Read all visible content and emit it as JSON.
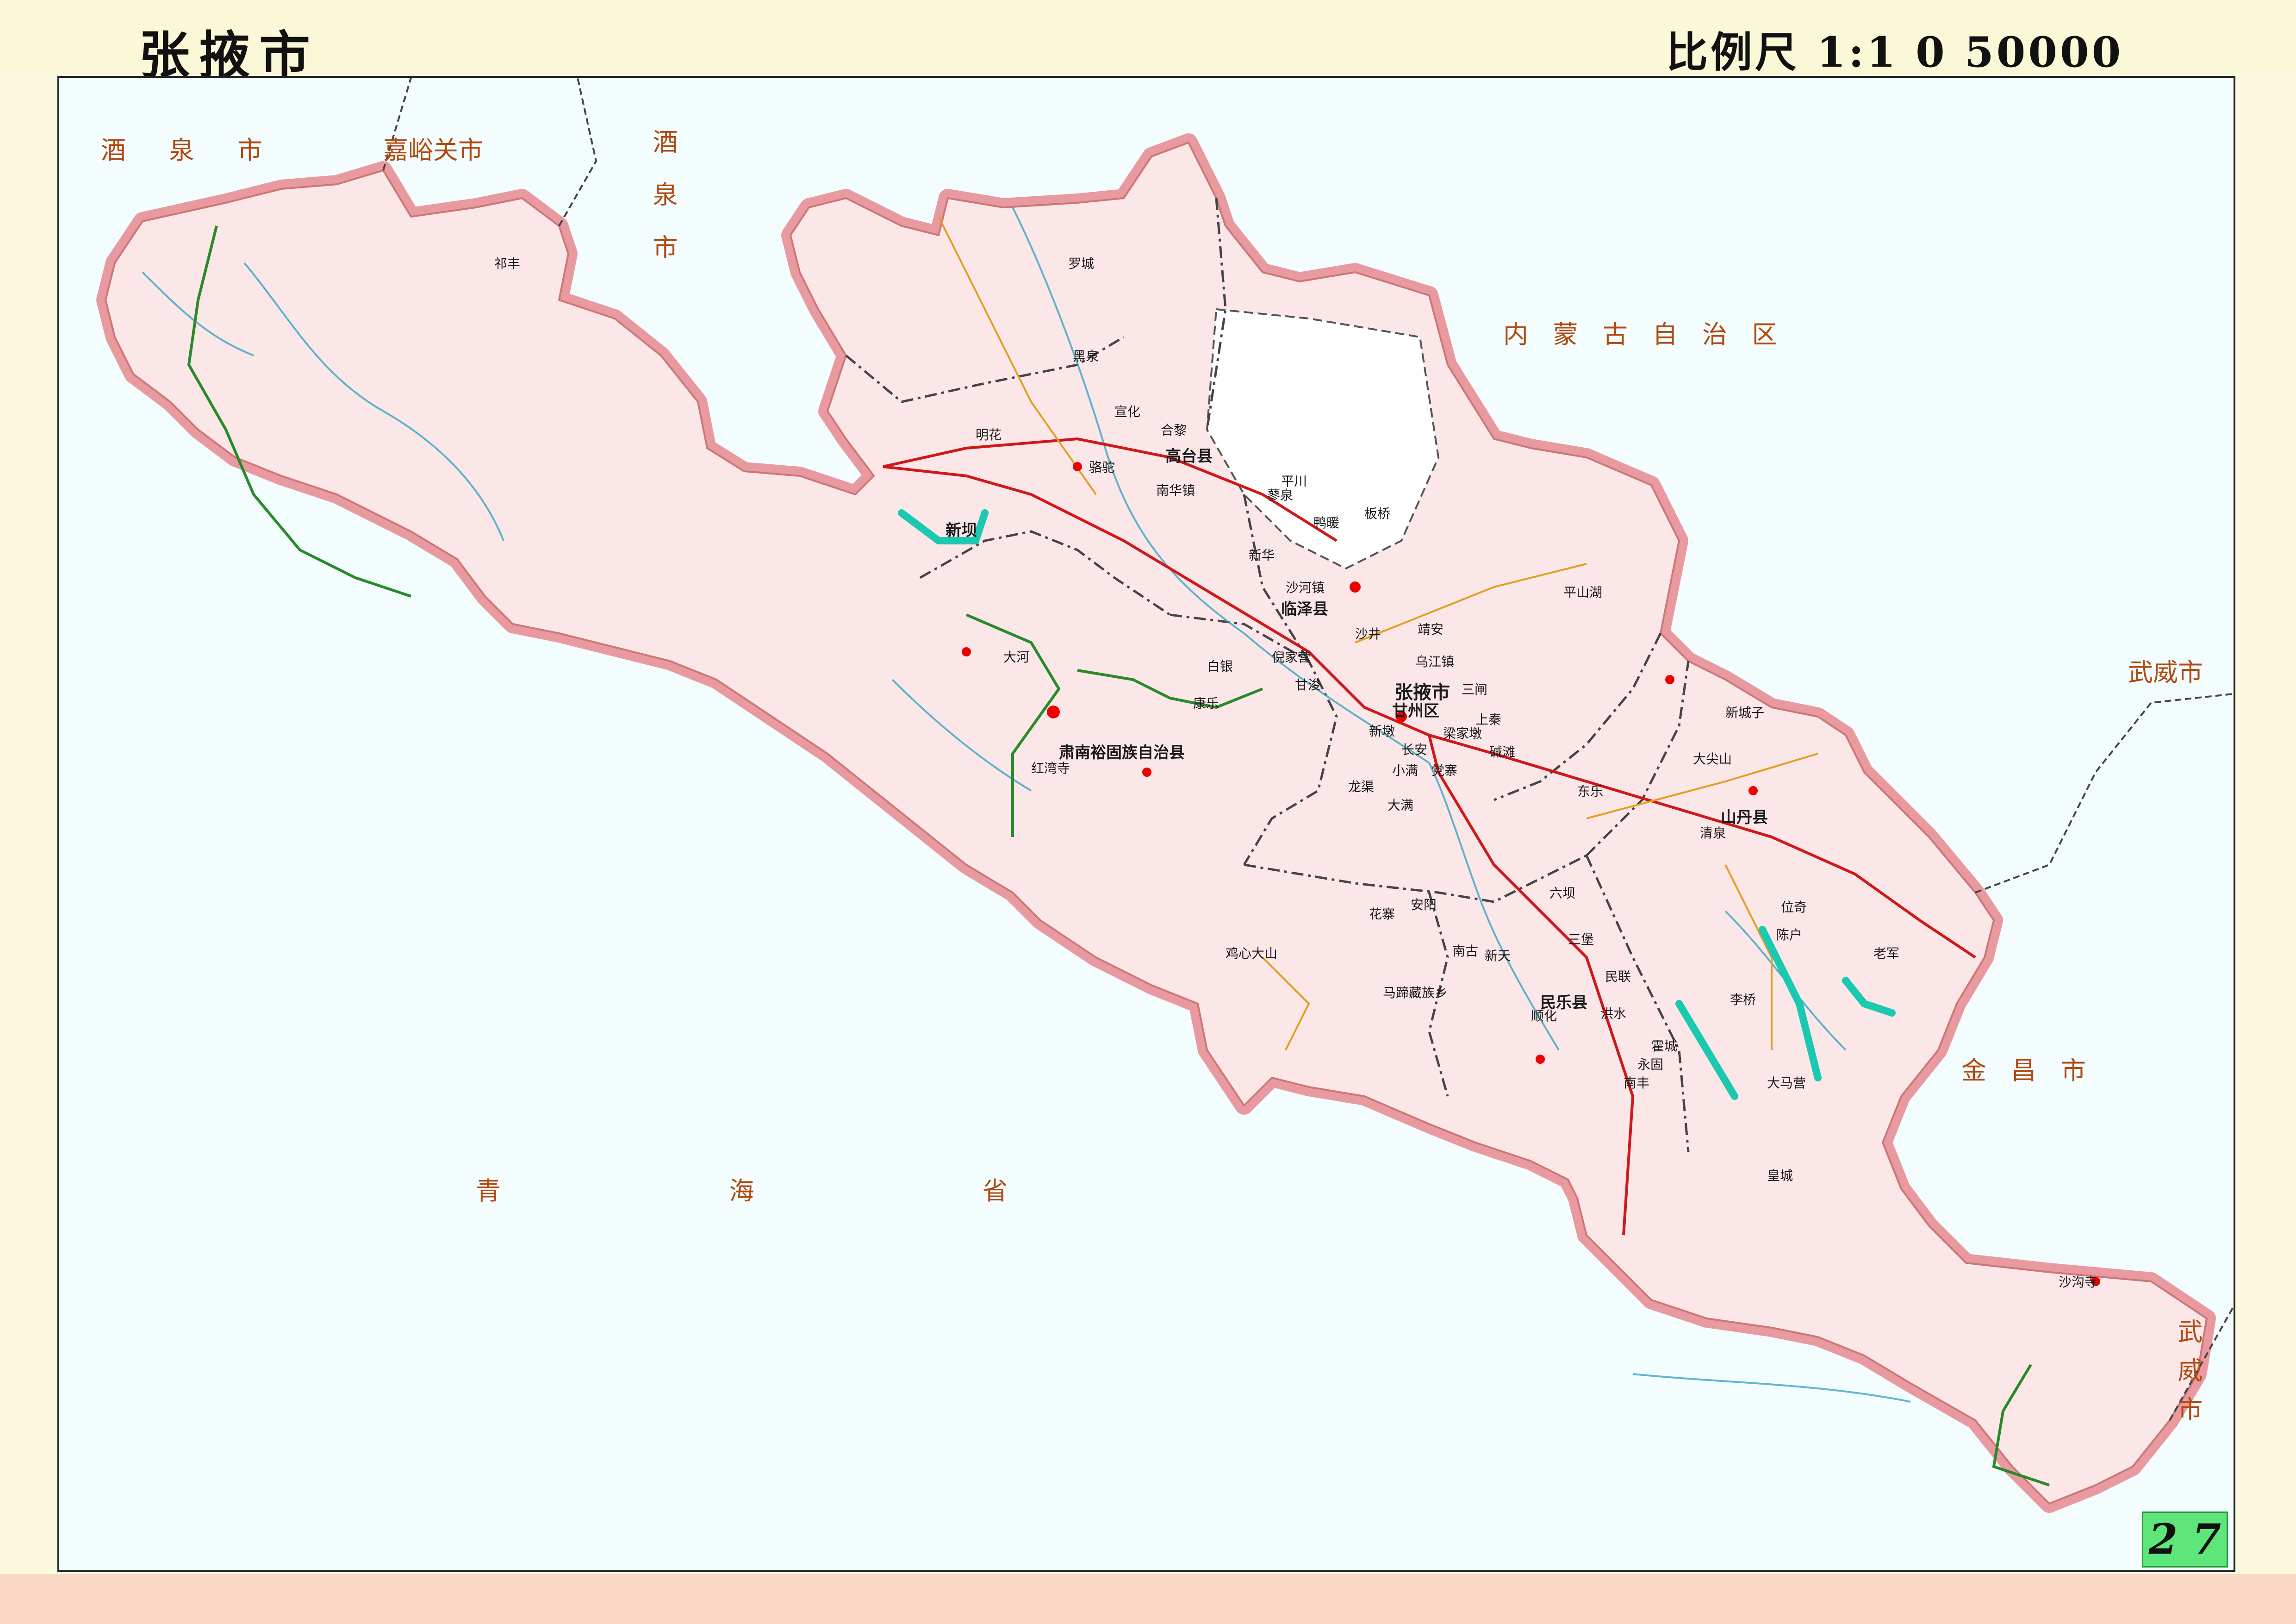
{
  "header": {
    "title": "张掖市",
    "scale": "比例尺 1:1 0 50000"
  },
  "page_number": "2 7",
  "colors": {
    "prefecture_fill": "#fbe6e8",
    "border_glow": "#e99aa0",
    "river": "#3aa5c4",
    "national_road": "#d01818",
    "provincial_road": "#e0a020",
    "railway": "#2a8a2a",
    "county_boundary": "#444444",
    "label_color": "#b04a12"
  },
  "neighbors": [
    {
      "name": "酒 泉 市",
      "orient": "h"
    },
    {
      "name": "嘉峪关市",
      "orient": "h"
    },
    {
      "name": "酒泉市",
      "orient": "v"
    },
    {
      "name": "内 蒙 古 自 治 区",
      "orient": "h"
    },
    {
      "name": "武威市",
      "orient": "h"
    },
    {
      "name": "金 昌 市",
      "orient": "h"
    },
    {
      "name": "武威市",
      "orient": "v"
    },
    {
      "name": "青 海 省",
      "orient": "h"
    }
  ],
  "places": [
    {
      "name": "张掖市",
      "type": "city"
    },
    {
      "name": "甘州区",
      "type": "county"
    },
    {
      "name": "高台县",
      "type": "county"
    },
    {
      "name": "临泽县",
      "type": "county"
    },
    {
      "name": "肃南裕固族自治县",
      "type": "county"
    },
    {
      "name": "民乐县",
      "type": "county"
    },
    {
      "name": "山丹县",
      "type": "county"
    },
    {
      "name": "罗城",
      "type": "town"
    },
    {
      "name": "黑泉",
      "type": "town"
    },
    {
      "name": "宣化",
      "type": "town"
    },
    {
      "name": "合黎",
      "type": "town"
    },
    {
      "name": "骆驼",
      "type": "town"
    },
    {
      "name": "南华镇",
      "type": "town"
    },
    {
      "name": "明花",
      "type": "town"
    },
    {
      "name": "新坝",
      "type": "town"
    },
    {
      "name": "平川",
      "type": "town"
    },
    {
      "name": "蓼泉",
      "type": "town"
    },
    {
      "name": "鸭暖",
      "type": "town"
    },
    {
      "name": "板桥",
      "type": "town"
    },
    {
      "name": "新华",
      "type": "town"
    },
    {
      "name": "沙河镇",
      "type": "town"
    },
    {
      "name": "倪家营",
      "type": "town"
    },
    {
      "name": "甘浚",
      "type": "town"
    },
    {
      "name": "白银",
      "type": "town"
    },
    {
      "name": "康乐",
      "type": "town"
    },
    {
      "name": "大河",
      "type": "town"
    },
    {
      "name": "红湾寺",
      "type": "town"
    },
    {
      "name": "平山湖",
      "type": "town"
    },
    {
      "name": "乌江镇",
      "type": "town"
    },
    {
      "name": "沙井",
      "type": "town"
    },
    {
      "name": "靖安",
      "type": "town"
    },
    {
      "name": "三闸",
      "type": "town"
    },
    {
      "name": "梁家墩",
      "type": "town"
    },
    {
      "name": "上秦",
      "type": "town"
    },
    {
      "name": "新墩",
      "type": "town"
    },
    {
      "name": "长安",
      "type": "town"
    },
    {
      "name": "碱滩",
      "type": "town"
    },
    {
      "name": "小满",
      "type": "town"
    },
    {
      "name": "党寨",
      "type": "town"
    },
    {
      "name": "龙渠",
      "type": "town"
    },
    {
      "name": "大满",
      "type": "town"
    },
    {
      "name": "东乐",
      "type": "town"
    },
    {
      "name": "清泉",
      "type": "town"
    },
    {
      "name": "位奇",
      "type": "town"
    },
    {
      "name": "陈户",
      "type": "town"
    },
    {
      "name": "老军",
      "type": "town"
    },
    {
      "name": "李桥",
      "type": "town"
    },
    {
      "name": "霍城",
      "type": "town"
    },
    {
      "name": "大马营",
      "type": "town"
    },
    {
      "name": "永固",
      "type": "town"
    },
    {
      "name": "南丰",
      "type": "town"
    },
    {
      "name": "顺化",
      "type": "town"
    },
    {
      "name": "洪水",
      "type": "town"
    },
    {
      "name": "民联",
      "type": "town"
    },
    {
      "name": "六坝",
      "type": "town"
    },
    {
      "name": "三堡",
      "type": "town"
    },
    {
      "name": "新天",
      "type": "town"
    },
    {
      "name": "南古",
      "type": "town"
    },
    {
      "name": "花寨",
      "type": "town"
    },
    {
      "name": "安阳",
      "type": "town"
    },
    {
      "name": "马蹄藏族乡",
      "type": "town"
    },
    {
      "name": "祁丰",
      "type": "town"
    },
    {
      "name": "皇城",
      "type": "town"
    },
    {
      "name": "沙沟寺",
      "type": "town"
    },
    {
      "name": "鸡心大山",
      "type": "town"
    },
    {
      "name": "新城子",
      "type": "town"
    },
    {
      "name": "大尖山",
      "type": "town"
    }
  ]
}
